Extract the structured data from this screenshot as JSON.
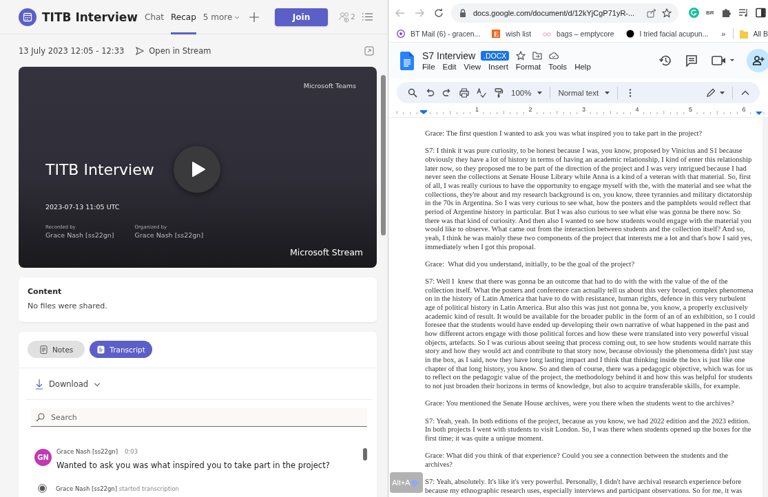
{
  "teams": {
    "title": "TITB Interview",
    "tabs": [
      {
        "label": "Chat",
        "selected": false
      },
      {
        "label": "Recap",
        "selected": true
      },
      {
        "label": "5 more",
        "selected": false,
        "kind": "overflow"
      }
    ],
    "join_button": "Join",
    "participant_count": "2",
    "meeting_time": "13 July 2023 12:05 - 12:33",
    "open_in_stream": "Open in Stream",
    "recording": {
      "brand_top": "Microsoft Teams",
      "title": "TITB Interview",
      "timestamp": "2023-07-13 11:05 UTC",
      "people": [
        {
          "label": "Recorded by",
          "name": "Grace Nash [ss22gn]"
        },
        {
          "label": "Organized by",
          "name": "Grace Nash [ss22gn]"
        }
      ],
      "brand_bottom": "Microsoft Stream"
    },
    "content": {
      "heading": "Content",
      "text": "No files were shared."
    },
    "view_tabs": [
      {
        "label": "Notes",
        "selected": false,
        "kind": "notes"
      },
      {
        "label": "Transcript",
        "selected": true,
        "kind": "transcript"
      }
    ],
    "download_button": "Download",
    "search": {
      "placeholder": "Search"
    },
    "transcript": [
      {
        "kind": "message",
        "initials": "GN",
        "color": "#c239b3",
        "speaker": "Grace Nash [ss22gn]",
        "time": "0:03",
        "text": "Wanted to ask you was what inspired you to take part in the project?"
      },
      {
        "kind": "event",
        "speaker": "Grace Nash [ss22gn]",
        "text": "started transcription"
      }
    ]
  },
  "browser": {
    "url": "docs.google.com/document/d/12kYjCgP71yR-...",
    "extension_badge": "BR",
    "bookmarks": [
      {
        "kind": "mail",
        "label": "BT Mail (6) - gracen..."
      },
      {
        "kind": "letter",
        "icon_text": "E",
        "label": "wish list"
      },
      {
        "kind": "glasses",
        "label": "bags – emptycore"
      },
      {
        "kind": "dot",
        "label": "I tried facial acupun..."
      }
    ],
    "bookmarks_overflow": "»",
    "bookmark_folder": "All B"
  },
  "docs": {
    "title": "S7 Interview",
    "file_badge": ".DOCX",
    "menu": [
      "File",
      "Edit",
      "View",
      "Insert",
      "Format",
      "Tools",
      "Help"
    ],
    "zoom": "100%",
    "style": "Normal text",
    "ruler_numbers": [
      "1",
      "2",
      "3",
      "4",
      "5",
      "6"
    ],
    "paragraphs": [
      "Grace: The first question I wanted to ask you was what inspired you to take part in the project?",
      "S7: I think it was pure curiosity, to be honest because I was, you know, proposed by Vinicius and S1 because obviously they have a lot of history in terms of having an academic relationship, I kind of enter this relationship later now, so they proposed me to be part of the direction of the project and I was very intrigued because I had never seen the collections at Senate House Library while Anna is a kind of a veteran with that material. So, first of all, I was really curious to have the opportunity to engage myself with the, with the material and see what the collections, they're about and my research background is on, you know, three tyrannies and military dictatorship in the 70s in Argentina. So I was very curious to see what, how the posters and the pamphlets would reflect that period of Argentine history in particular. But I was also curious to see what else was gonna be there now. So there was that kind of curiosity. And then also I wanted to see how students would engage with the material you would like to observe. What came out from the interaction between students and the collection itself? And so, yeah, I think he was mainly these two components of the project that interests me a lot and that's how I said yes, immediately when I got this proposal.",
      "Grace:  What did you understand, initially, to be the goal of the project?",
      "S7: Well I  knew that there was gonna be an outcome that had to do with the with the value of the of the collection itself. What the posters and conference can actually tell us about this very broad, complex phenomena on in the history of Latin America that have to do with resistance, human rights, defence in this very turbulent age of political history in Latin America. But also this was just not gonna be, you know, a properly exclusively academic kind of result. It would be available for the broader public in the form of an of an exhibition, so I could foresee that the students would have ended up developing their own narrative of what happened in the past and how different actors engage with those political forces and how these were translated into very powerful visual objects, artefacts. So I was curious about seeing that process coming out, to see how students would narrate this story and how they would act and contribute to that story now, because obviously the phenomena didn't just stay in the box, as I said, now they have long lasting impact and I think that thinking inside the box is just like one chapter of that long history, you know. So and then of course, there was a pedagogic objective, which was for us to reflect on the pedagogic value of the project, the methodology behind it and how this was helpful for students to not just broaden their horizons in terms of knowledge, but also to acquire transferable skills, for example.",
      "Grace: You mentioned the Senate House archives, were you there when the students went to the archives?",
      "S7: Yeah, yeah. In both editions of the project, because as you know, we had 2022 edition and the 2023 edition. In both projects I went with students to visit London. So, I was there when students opened up the boxes for the first time; it was quite a unique moment.",
      "Grace: What did you think of that experience? Could you see a connection between the students and the archives?",
      "S7: Yeah, absolutely. It's like it's very powerful. Personally, I didn't have archival research experience before because my ethnographic research uses, especially interviews and participant observations. So for me, it was"
    ]
  },
  "shortcut_hint": "Alt+A"
}
